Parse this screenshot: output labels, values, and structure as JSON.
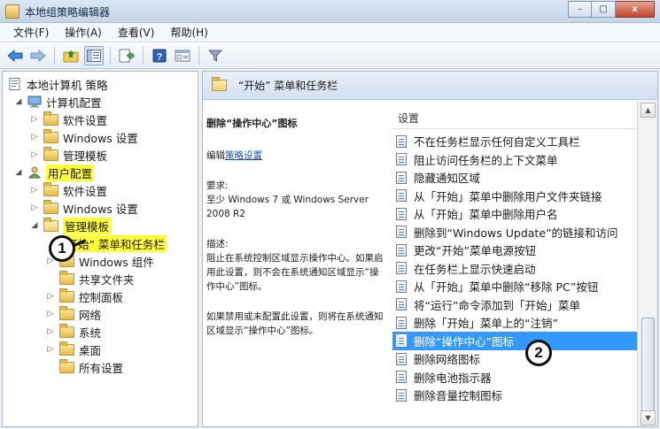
{
  "window": {
    "title": "本地组策略编辑器",
    "buttons": {
      "minimize": "–",
      "maximize": "□",
      "close": "x"
    }
  },
  "menu": [
    "文件(F)",
    "操作(A)",
    "查看(V)",
    "帮助(H)"
  ],
  "toolbar": {
    "icons": [
      "back-arrow-icon",
      "forward-arrow-icon",
      "folder-up-icon",
      "show-hide-tree-icon",
      "export-list-icon",
      "help-icon",
      "properties-icon",
      "filter-icon"
    ]
  },
  "tree": {
    "root": "本地计算机 策略",
    "computer_config": "计算机配置",
    "computer_children": [
      "软件设置",
      "Windows 设置",
      "管理模板"
    ],
    "user_config": "用户配置",
    "user_children": [
      "软件设置",
      "Windows 设置"
    ],
    "admin_templates": "管理模板",
    "start_menu": "“开始” 菜单和任务栏",
    "admin_children": [
      "Windows 组件",
      "共享文件夹",
      "控制面板",
      "网络",
      "系统",
      "桌面",
      "所有设置"
    ]
  },
  "right": {
    "header_title": "“开始” 菜单和任务栏",
    "desc": {
      "title": "删除“操作中心”图标",
      "edit_prefix": "编辑",
      "edit_link": "策略设置",
      "req_label": "要求:",
      "req_text": "至少 Windows 7 或 Windows Server 2008 R2",
      "desc_label": "描述:",
      "desc_text": "阻止在系统控制区域显示操作中心。如果启用此设置，则不会在系统通知区域显示“操作中心”图标。",
      "desc_text2": "如果禁用或未配置此设置，则将在系统通知区域显示“操作中心”图标。"
    },
    "list_header": "设置",
    "items": [
      "不在任务栏显示任何自定义工具栏",
      "阻止访问任务栏的上下文菜单",
      "隐藏通知区域",
      "从「开始」菜单中删除用户文件夹链接",
      "从「开始」菜单中删除用户名",
      "删除到“Windows Update”的链接和访问",
      "更改“开始”菜单电源按钮",
      "在任务栏上显示快速启动",
      "从「开始」菜单中删除“移除 PC”按钮",
      "将“运行”命令添加到「开始」菜单",
      "删除「开始」菜单上的“注销”",
      "删除“操作中心”图标",
      "删除网络图标",
      "删除电池指示器",
      "删除音量控制图标"
    ],
    "selected_index": 11
  },
  "callouts": [
    "1",
    "2"
  ],
  "colors": {
    "selection": "#3399ff",
    "highlight": "#ffff33"
  }
}
